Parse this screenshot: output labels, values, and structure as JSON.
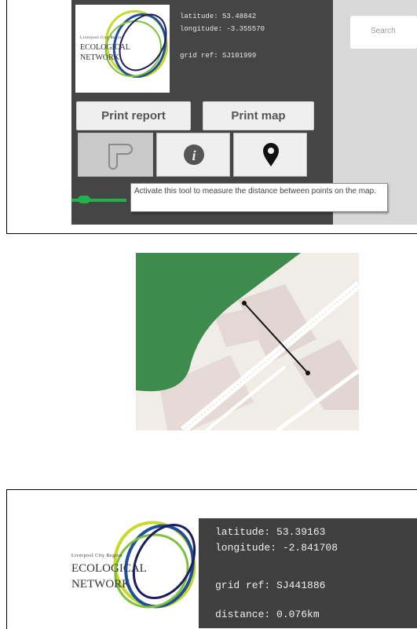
{
  "top": {
    "logo": {
      "line1": "Liverpool City Region",
      "line2": "Ecological",
      "line3": "Network"
    },
    "coords": {
      "latitude": "latitude: 53.48842",
      "longitude": "longitude: -3.355570",
      "grid_ref": "grid ref: SJ101999"
    },
    "search": {
      "placeholder": "Search"
    },
    "buttons": {
      "print_report": "Print report",
      "print_map": "Print map"
    },
    "tools": [
      {
        "name": "measure",
        "icon": "ruler-icon",
        "active": true
      },
      {
        "name": "info",
        "icon": "info-icon",
        "active": false
      },
      {
        "name": "marker",
        "icon": "map-marker-icon",
        "active": false
      }
    ],
    "tooltip": "Activate this tool to measure the distance between points on the map."
  },
  "bottom": {
    "logo": {
      "line1": "Liverpool City Region",
      "line2": "Ecological",
      "line3": "Network"
    },
    "coords": {
      "latitude": "latitude: 53.39163",
      "longitude": "longitude: -2.841708",
      "grid_ref": "grid ref: SJ441886",
      "distance": "distance: 0.076km"
    }
  },
  "colors": {
    "panel": "#454545",
    "green_area": "#3e8b4e",
    "measure_line": "#22b24c"
  }
}
